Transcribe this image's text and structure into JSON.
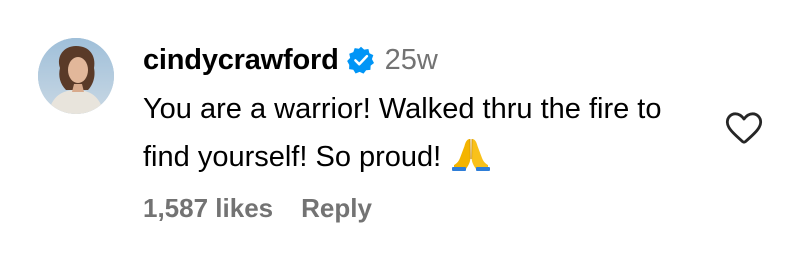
{
  "comment": {
    "username": "cindycrawford",
    "verified": true,
    "timestamp": "25w",
    "text": "You are a warrior! Walked thru the fire to find yourself! So proud!",
    "emoji": "folded-hands",
    "likes": "1,587 likes",
    "reply_label": "Reply"
  },
  "icons": {
    "verified": "verified-badge-icon",
    "like": "heart-outline-icon"
  },
  "colors": {
    "verified_blue": "#0095f6",
    "meta_gray": "#737373",
    "text": "#000000"
  }
}
